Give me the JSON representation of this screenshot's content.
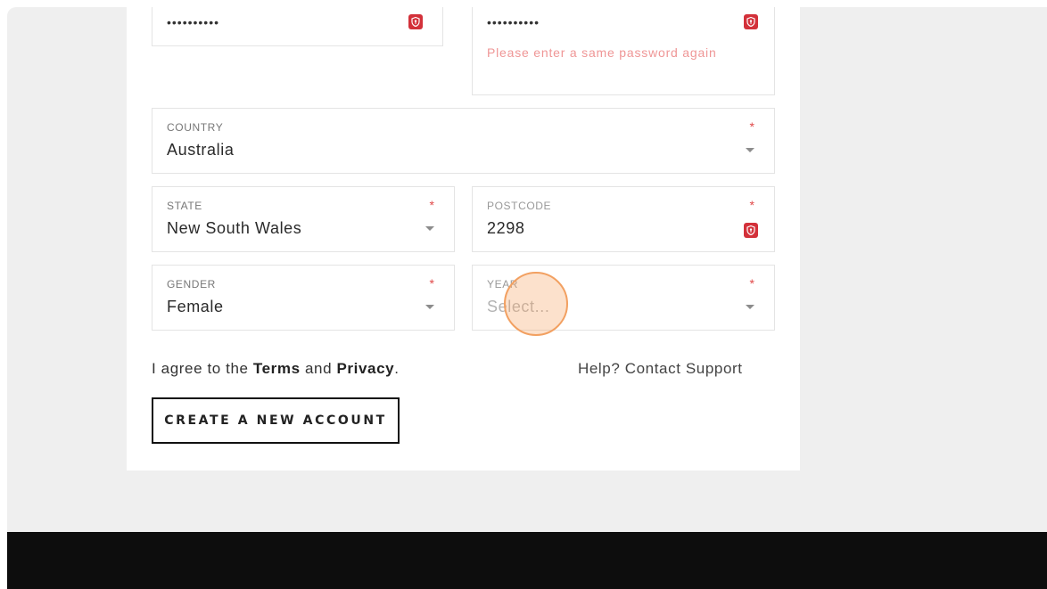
{
  "form": {
    "password": {
      "value": "••••••••••"
    },
    "confirm_password": {
      "value": "••••••••••",
      "error": "Please enter a same password again"
    },
    "country": {
      "label": "COUNTRY",
      "value": "Australia",
      "required": "*"
    },
    "state": {
      "label": "STATE",
      "value": "New South Wales",
      "required": "*"
    },
    "postcode": {
      "label": "POSTCODE",
      "value": "2298",
      "required": "*"
    },
    "gender": {
      "label": "GENDER",
      "value": "Female",
      "required": "*"
    },
    "year": {
      "label": "YEAR",
      "placeholder": "Select...",
      "required": "*"
    }
  },
  "terms": {
    "prefix": "I agree to the ",
    "terms_link": "Terms",
    "middle": " and ",
    "privacy_link": "Privacy",
    "suffix": "."
  },
  "support_text": "Help? Contact Support",
  "create_button_label": "CREATE A NEW ACCOUNT",
  "colors": {
    "error": "#ef9696",
    "required": "#e04848",
    "password_icon": "#d3313a",
    "footer": "#0d0d0d"
  },
  "icons": {
    "password_manager": "shield-key-icon",
    "dropdown": "caret-down-icon"
  }
}
